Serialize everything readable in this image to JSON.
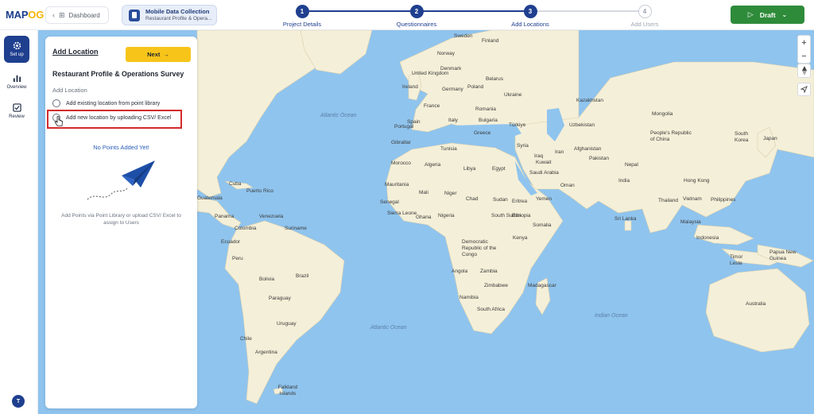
{
  "logo": {
    "part1": "MAP",
    "part2": "OG"
  },
  "header": {
    "dashboard_label": "Dashboard",
    "project_title": "Mobile Data Collection",
    "project_subtitle": "Restaurant Profile & Opera...",
    "steps": [
      {
        "num": "1",
        "label": "Project Details",
        "state": "done"
      },
      {
        "num": "2",
        "label": "Questionnaires",
        "state": "done"
      },
      {
        "num": "3",
        "label": "Add Locations",
        "state": "done"
      },
      {
        "num": "4",
        "label": "Add Users",
        "state": "upcoming"
      }
    ],
    "draft_label": "Draft"
  },
  "sidebar": {
    "items": [
      {
        "label": "Set up",
        "icon": "gear-icon",
        "active": true
      },
      {
        "label": "Overview",
        "icon": "bar-chart-icon",
        "active": false
      },
      {
        "label": "Review",
        "icon": "checkbox-icon",
        "active": false
      }
    ],
    "avatar_initial": "T"
  },
  "panel": {
    "title": "Add Location",
    "next_label": "Next",
    "survey_title": "Restaurant Profile & Operations Survey",
    "section_label": "Add Location",
    "options": [
      "Add existing location from point library",
      "Add new location by uploading CSV/ Excel"
    ],
    "empty_title": "No Points Added Yet!",
    "empty_help": "Add Points via Point Library or upload CSV/ Excel to assign to Users"
  },
  "map": {
    "oceans": [
      "Atlantic Ocean",
      "Atlantic Ocean",
      "Indian Ocean"
    ],
    "labels": [
      "Sweden",
      "Finland",
      "Norway",
      "Denmark",
      "United Kingdom",
      "Ireland",
      "Germany",
      "Poland",
      "Belarus",
      "France",
      "Romania",
      "Ukraine",
      "Spain",
      "Portugal",
      "Italy",
      "Bulgaria",
      "Greece",
      "Türkiye",
      "Morocco",
      "Algeria",
      "Libya",
      "Egypt",
      "Tunisia",
      "Mauritania",
      "Mali",
      "Niger",
      "Chad",
      "Sudan",
      "Eritrea",
      "Ethiopia",
      "Nigeria",
      "Ghana",
      "Senegal",
      "Sierra Leone",
      "Kenya",
      "Somalia",
      "South Sudan",
      "Democratic Republic of the Congo",
      "Angola",
      "Zambia",
      "Zimbabwe",
      "Namibia",
      "South Africa",
      "Madagascar",
      "Saudi Arabia",
      "Iraq",
      "Iran",
      "Syria",
      "Kuwait",
      "Yemen",
      "Oman",
      "Afghanistan",
      "Pakistan",
      "India",
      "Nepal",
      "Sri Lanka",
      "Kazakhstan",
      "Uzbekistan",
      "Mongolia",
      "People's Republic of China",
      "South Korea",
      "Japan",
      "Hong Kong",
      "Vietnam",
      "Thailand",
      "Philippines",
      "Malaysia",
      "Indonesia",
      "Timor Leste",
      "Papua New Guinea",
      "Australia",
      "Cuba",
      "Puerto Rico",
      "Guatemala",
      "Panama",
      "Colombia",
      "Venezuela",
      "Suriname",
      "Ecuador",
      "Peru",
      "Brazil",
      "Bolivia",
      "Paraguay",
      "Chile",
      "Uruguay",
      "Argentina",
      "Falkland Islands",
      "Gibraltar",
      "Algeria"
    ]
  },
  "colors": {
    "primary": "#1f3f8f",
    "accent": "#f7c41a",
    "draft": "#2e8b3a",
    "ocean": "#8fc4ee",
    "highlight": "#d42a2a"
  }
}
